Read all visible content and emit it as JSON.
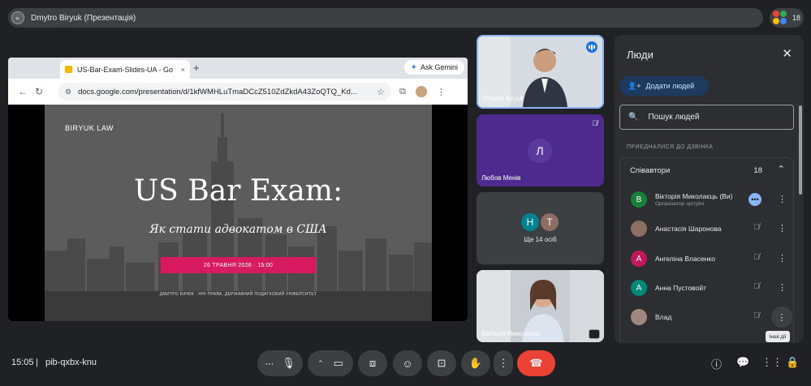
{
  "meeting": {
    "presenter_title": "Dmytro Biryuk (Презентація)",
    "participant_count": "18",
    "time": "15:05",
    "separator": "|",
    "code": "pib-qxbx-knu"
  },
  "browser": {
    "tab_title": "US-Bar-Exam-Slides-UA - Go",
    "tab_close": "×",
    "new_tab": "+",
    "gemini_label": "Ask Gemini",
    "url": "docs.google.com/presentation/d/1kfWMHLuTmaDCcZ510ZdZkdA43ZoQTQ_Kd..."
  },
  "slide": {
    "brand": "BIRYUK LAW",
    "headline": "US Bar Exam:",
    "subhead": "Як стати адвокатом в США",
    "date": "26 ТРАВНЯ 2026  ·  15:00",
    "footer": "ДМИТРО БІРЮК  ·  ННІ ПРАВА, ДЕРЖАВНИЙ ПОДАТКОВИЙ УНІВЕРСИТЕТ"
  },
  "tiles": {
    "tile1_name": "Dmytro Biryuk",
    "tile2_letter": "Л",
    "tile2_name": "Любов Менів",
    "tile3_letters": [
      "Н",
      "Т"
    ],
    "tile3_text": "Ще 14 осіб",
    "tile4_name": "Вікторія Миколаєць"
  },
  "people_panel": {
    "title": "Люди",
    "add_button": "Додати людей",
    "search_placeholder": "Пошук людей",
    "joined_label": "ПРИЄДНАЛИСЯ ДО ДЗВІНКА",
    "group_label": "Співавтори",
    "group_count": "18",
    "participants": [
      {
        "initial": "В",
        "name": "Вікторія Миколаєць (Ви)",
        "role": "Організатор зустрічі",
        "color": "#188038"
      },
      {
        "initial": "",
        "name": "Анастасія Шаронова",
        "role": "",
        "color": "#8d6e63"
      },
      {
        "initial": "А",
        "name": "Ангеліна Власенко",
        "color": "#c2185b"
      },
      {
        "initial": "А",
        "name": "Анна Пустовойт",
        "color": "#00897b"
      },
      {
        "initial": "",
        "name": "Влад",
        "color": "#a1887f"
      }
    ],
    "tooltip": "Інші дії"
  },
  "colors": {
    "accent": "#8ab4f8",
    "hangup": "#ea4335",
    "slide_date_bar": "#d81b60"
  }
}
